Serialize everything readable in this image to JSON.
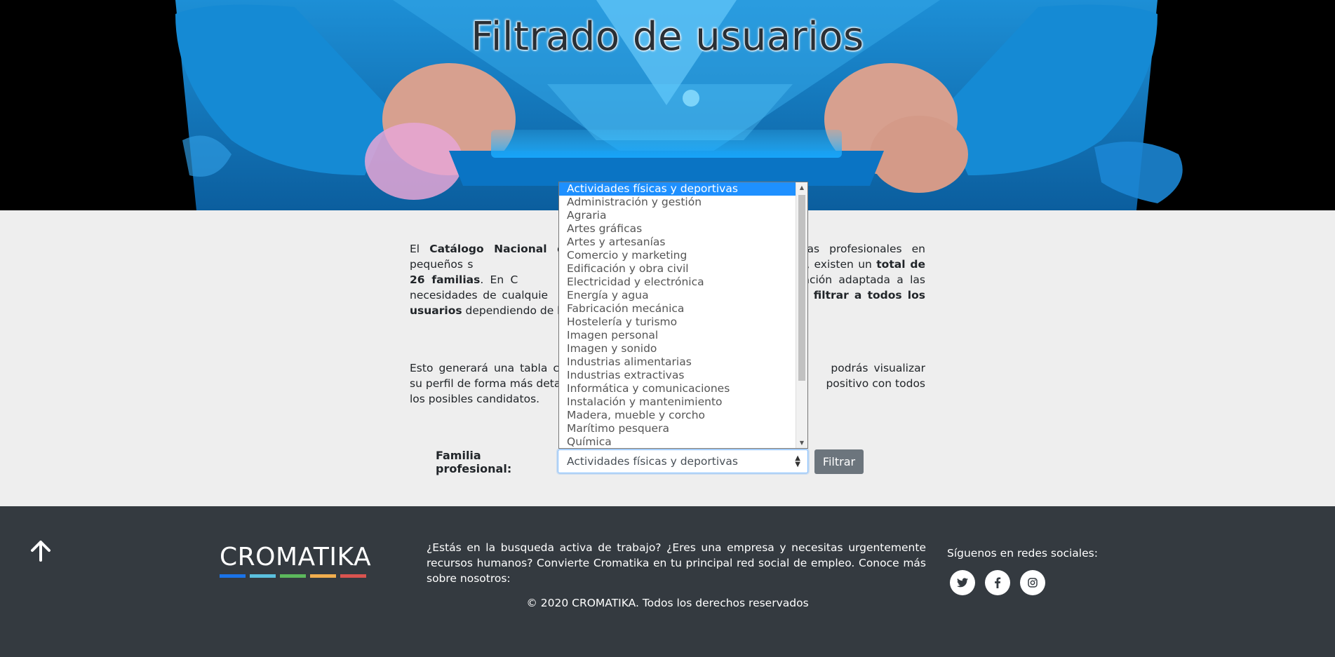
{
  "hero": {
    "title": "Filtrado de usuarios"
  },
  "intro": {
    "p1_pre": "El ",
    "p1_bold1": "Catálogo Nacional d",
    "p1_mid1": " las distintas áreas profesionales en pequeños s",
    "p1_mid2": "tualmente, existen un ",
    "p1_bold2": "total de 26 familias",
    "p1_mid3": ". En C",
    "p1_mid4": "formación adaptada a las necesidades de cualquie",
    "p1_bold3": "e filtrar a todos los usuarios",
    "p1_end": " dependiendo de la",
    "p2_a": "Esto generará una tabla co",
    "p2_b": " podrás visualizar su perfil de forma más detalla",
    "p2_c": "positivo con todos los posibles candidatos."
  },
  "filter": {
    "label": "Familia profesional:",
    "selected": "Actividades físicas y deportivas",
    "button": "Filtrar",
    "options": [
      "Actividades físicas y deportivas",
      "Administración y gestión",
      "Agraria",
      "Artes gráficas",
      "Artes y artesanías",
      "Comercio y marketing",
      "Edificación y obra civil",
      "Electricidad y electrónica",
      "Energía y agua",
      "Fabricación mecánica",
      "Hostelería y turismo",
      "Imagen personal",
      "Imagen y sonido",
      "Industrias alimentarias",
      "Industrias extractivas",
      "Informática y comunicaciones",
      "Instalación y mantenimiento",
      "Madera, mueble y corcho",
      "Marítimo pesquera",
      "Química"
    ]
  },
  "footer": {
    "logo": "CROMATIKA",
    "logo_colors": [
      "#1a73e8",
      "#5bc0de",
      "#5cb85c",
      "#f0ad4e",
      "#d9534f"
    ],
    "text": "¿Estás en la busqueda activa de trabajo? ¿Eres una empresa y necesitas urgentemente recursos humanos? Convierte Cromatika en tu principal red social de empleo. Conoce más sobre nosotros:",
    "copyright": "© 2020 CROMATIKA. Todos los derechos reservados",
    "social_label": "Síguenos en redes sociales:",
    "social_icons": [
      "twitter-icon",
      "facebook-icon",
      "instagram-icon"
    ]
  }
}
